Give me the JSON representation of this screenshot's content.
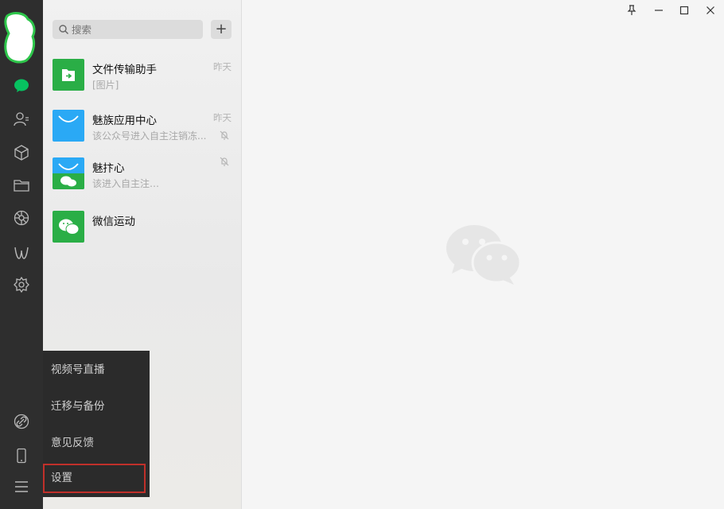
{
  "sidebar": {
    "nav": [
      {
        "icon": "chat-icon",
        "active": true
      },
      {
        "icon": "contacts-icon"
      },
      {
        "icon": "cube-icon"
      },
      {
        "icon": "folder-icon"
      },
      {
        "icon": "moments-icon"
      },
      {
        "icon": "mini-program-icon"
      },
      {
        "icon": "settings-gear-icon"
      },
      {
        "icon": "link-icon"
      },
      {
        "icon": "phone-icon"
      },
      {
        "icon": "menu-icon"
      }
    ]
  },
  "search": {
    "placeholder": "搜索",
    "add_label": "+"
  },
  "chats": [
    {
      "name": "文件传输助手",
      "message": "[图片]",
      "time": "昨天"
    },
    {
      "name": "魅族应用中心",
      "message": "该公众号进入自主注销冻...",
      "time": "昨天"
    },
    {
      "name": "魅抃心",
      "message": "该进入自主注…",
      "time": ""
    },
    {
      "name": "微信运动",
      "message": "",
      "time": ""
    }
  ],
  "menu": {
    "items": [
      "视频号直播",
      "迁移与备份",
      "意见反馈",
      "设置"
    ],
    "selected": "设置"
  },
  "window": {
    "pin": "pin-icon",
    "minimize": "minimize-icon",
    "maximize": "maximize-icon",
    "close": "close-icon"
  },
  "colors": {
    "wechat_green": "#07c160",
    "accent_blue": "#2aa9f5",
    "highlight_red": "#c0302a"
  }
}
